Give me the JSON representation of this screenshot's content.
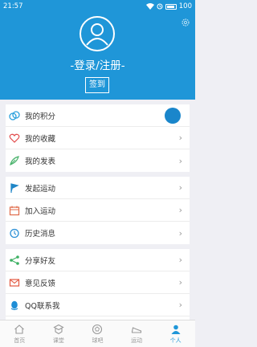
{
  "status_bar": {
    "time": "21:57",
    "battery": "100"
  },
  "profile": {
    "login_text": "-登录/注册-",
    "signin_label": "签到"
  },
  "menu_groups": [
    {
      "items": [
        {
          "label": "我的积分",
          "icon": "points-icon"
        },
        {
          "label": "我的收藏",
          "icon": "favorite-icon"
        },
        {
          "label": "我的发表",
          "icon": "publish-icon"
        }
      ]
    },
    {
      "items": [
        {
          "label": "发起运动",
          "icon": "flag-icon"
        },
        {
          "label": "加入运动",
          "icon": "calendar-icon"
        },
        {
          "label": "历史消息",
          "icon": "clock-icon"
        }
      ]
    },
    {
      "items": [
        {
          "label": "分享好友",
          "icon": "share-icon"
        },
        {
          "label": "意见反馈",
          "icon": "mail-icon"
        },
        {
          "label": "QQ联系我",
          "icon": "qq-icon"
        },
        {
          "label": "",
          "icon": "cut-off-icon"
        }
      ]
    }
  ],
  "tabs": [
    {
      "label": "首页",
      "icon": "home-icon"
    },
    {
      "label": "课堂",
      "icon": "classroom-icon"
    },
    {
      "label": "球吧",
      "icon": "ball-icon"
    },
    {
      "label": "运动",
      "icon": "shoe-icon"
    },
    {
      "label": "个人",
      "icon": "person-icon",
      "active": true
    }
  ],
  "colors": {
    "primary": "#1f96d8",
    "background": "#efeff4"
  }
}
